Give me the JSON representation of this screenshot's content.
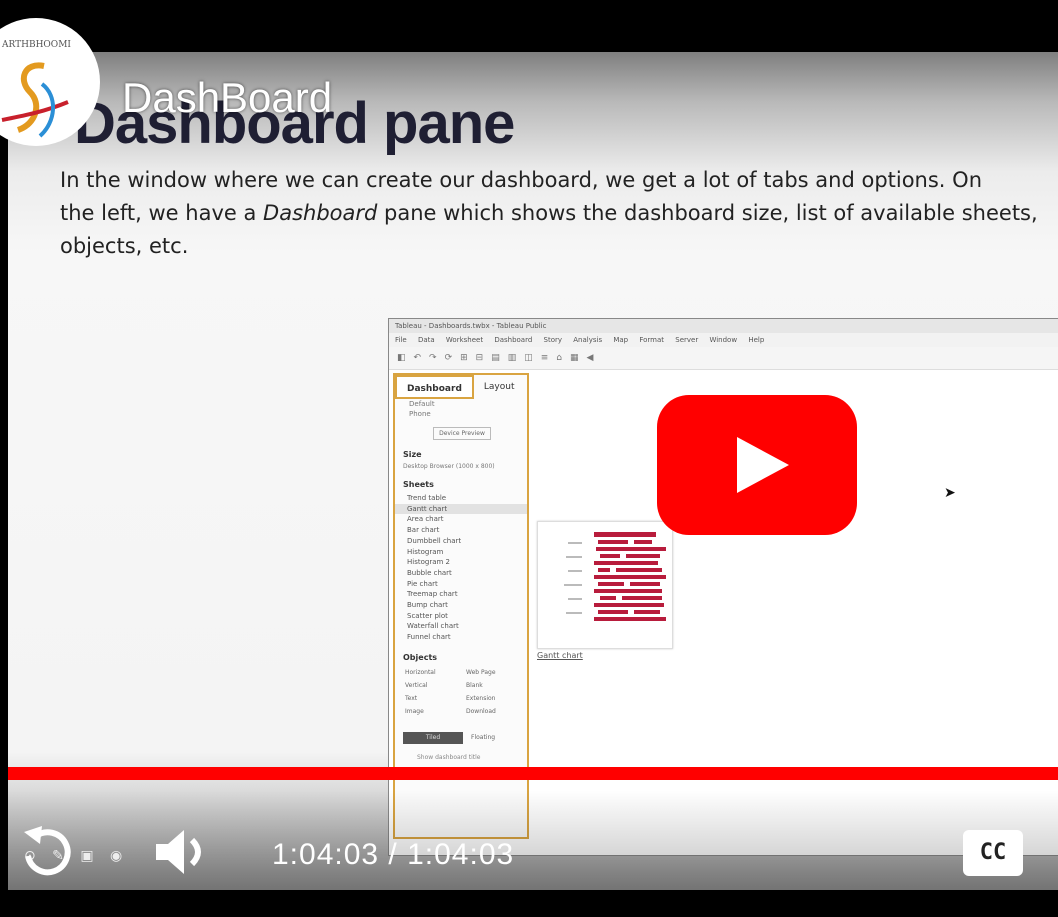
{
  "slide": {
    "title": "Dashboard pane",
    "body_line1": "In the window where we can create our dashboard, we get a lot of tabs and options. On",
    "body_line2_a": "the left, we have a ",
    "body_line2_em": "Dashboard",
    "body_line2_b": " pane which shows the dashboard size, list of available sheets,",
    "body_line3": "objects, etc."
  },
  "logo": {
    "text": "ARTHBHOOMI"
  },
  "channel_title": "DashBoard",
  "tableau": {
    "titlebar": "Tableau - Dashboards.twbx - Tableau Public",
    "menu": [
      "File",
      "Data",
      "Worksheet",
      "Dashboard",
      "Story",
      "Analysis",
      "Map",
      "Format",
      "Server",
      "Window",
      "Help"
    ],
    "tabs": [
      "Dashboard",
      "Layout"
    ],
    "device": [
      "Default",
      "Phone"
    ],
    "device_button": "Device Preview",
    "size_label": "Size",
    "size_value": "Desktop Browser (1000 x 800)",
    "sheets_label": "Sheets",
    "sheets": [
      "Trend table",
      "Gantt chart",
      "Area chart",
      "Bar chart",
      "Dumbbell chart",
      "Histogram",
      "Histogram 2",
      "Bubble chart",
      "Pie chart",
      "Treemap chart",
      "Bump chart",
      "Scatter plot",
      "Waterfall chart",
      "Funnel chart"
    ],
    "selected_sheet": "Gantt chart",
    "objects_label": "Objects",
    "objects": [
      "Horizontal",
      "Vertical",
      "Text",
      "Image",
      "Web Page",
      "Blank",
      "Extension",
      "Download"
    ],
    "tiled": "Tiled",
    "floating": "Floating",
    "show_title": "Show dashboard title",
    "chart_caption": "Gantt chart"
  },
  "player": {
    "time": "1:04:03 / 1:04:03",
    "cc_label": "CC",
    "progress": 1.0,
    "progress_color": "#ff0000",
    "play_color": "#ff0000"
  }
}
